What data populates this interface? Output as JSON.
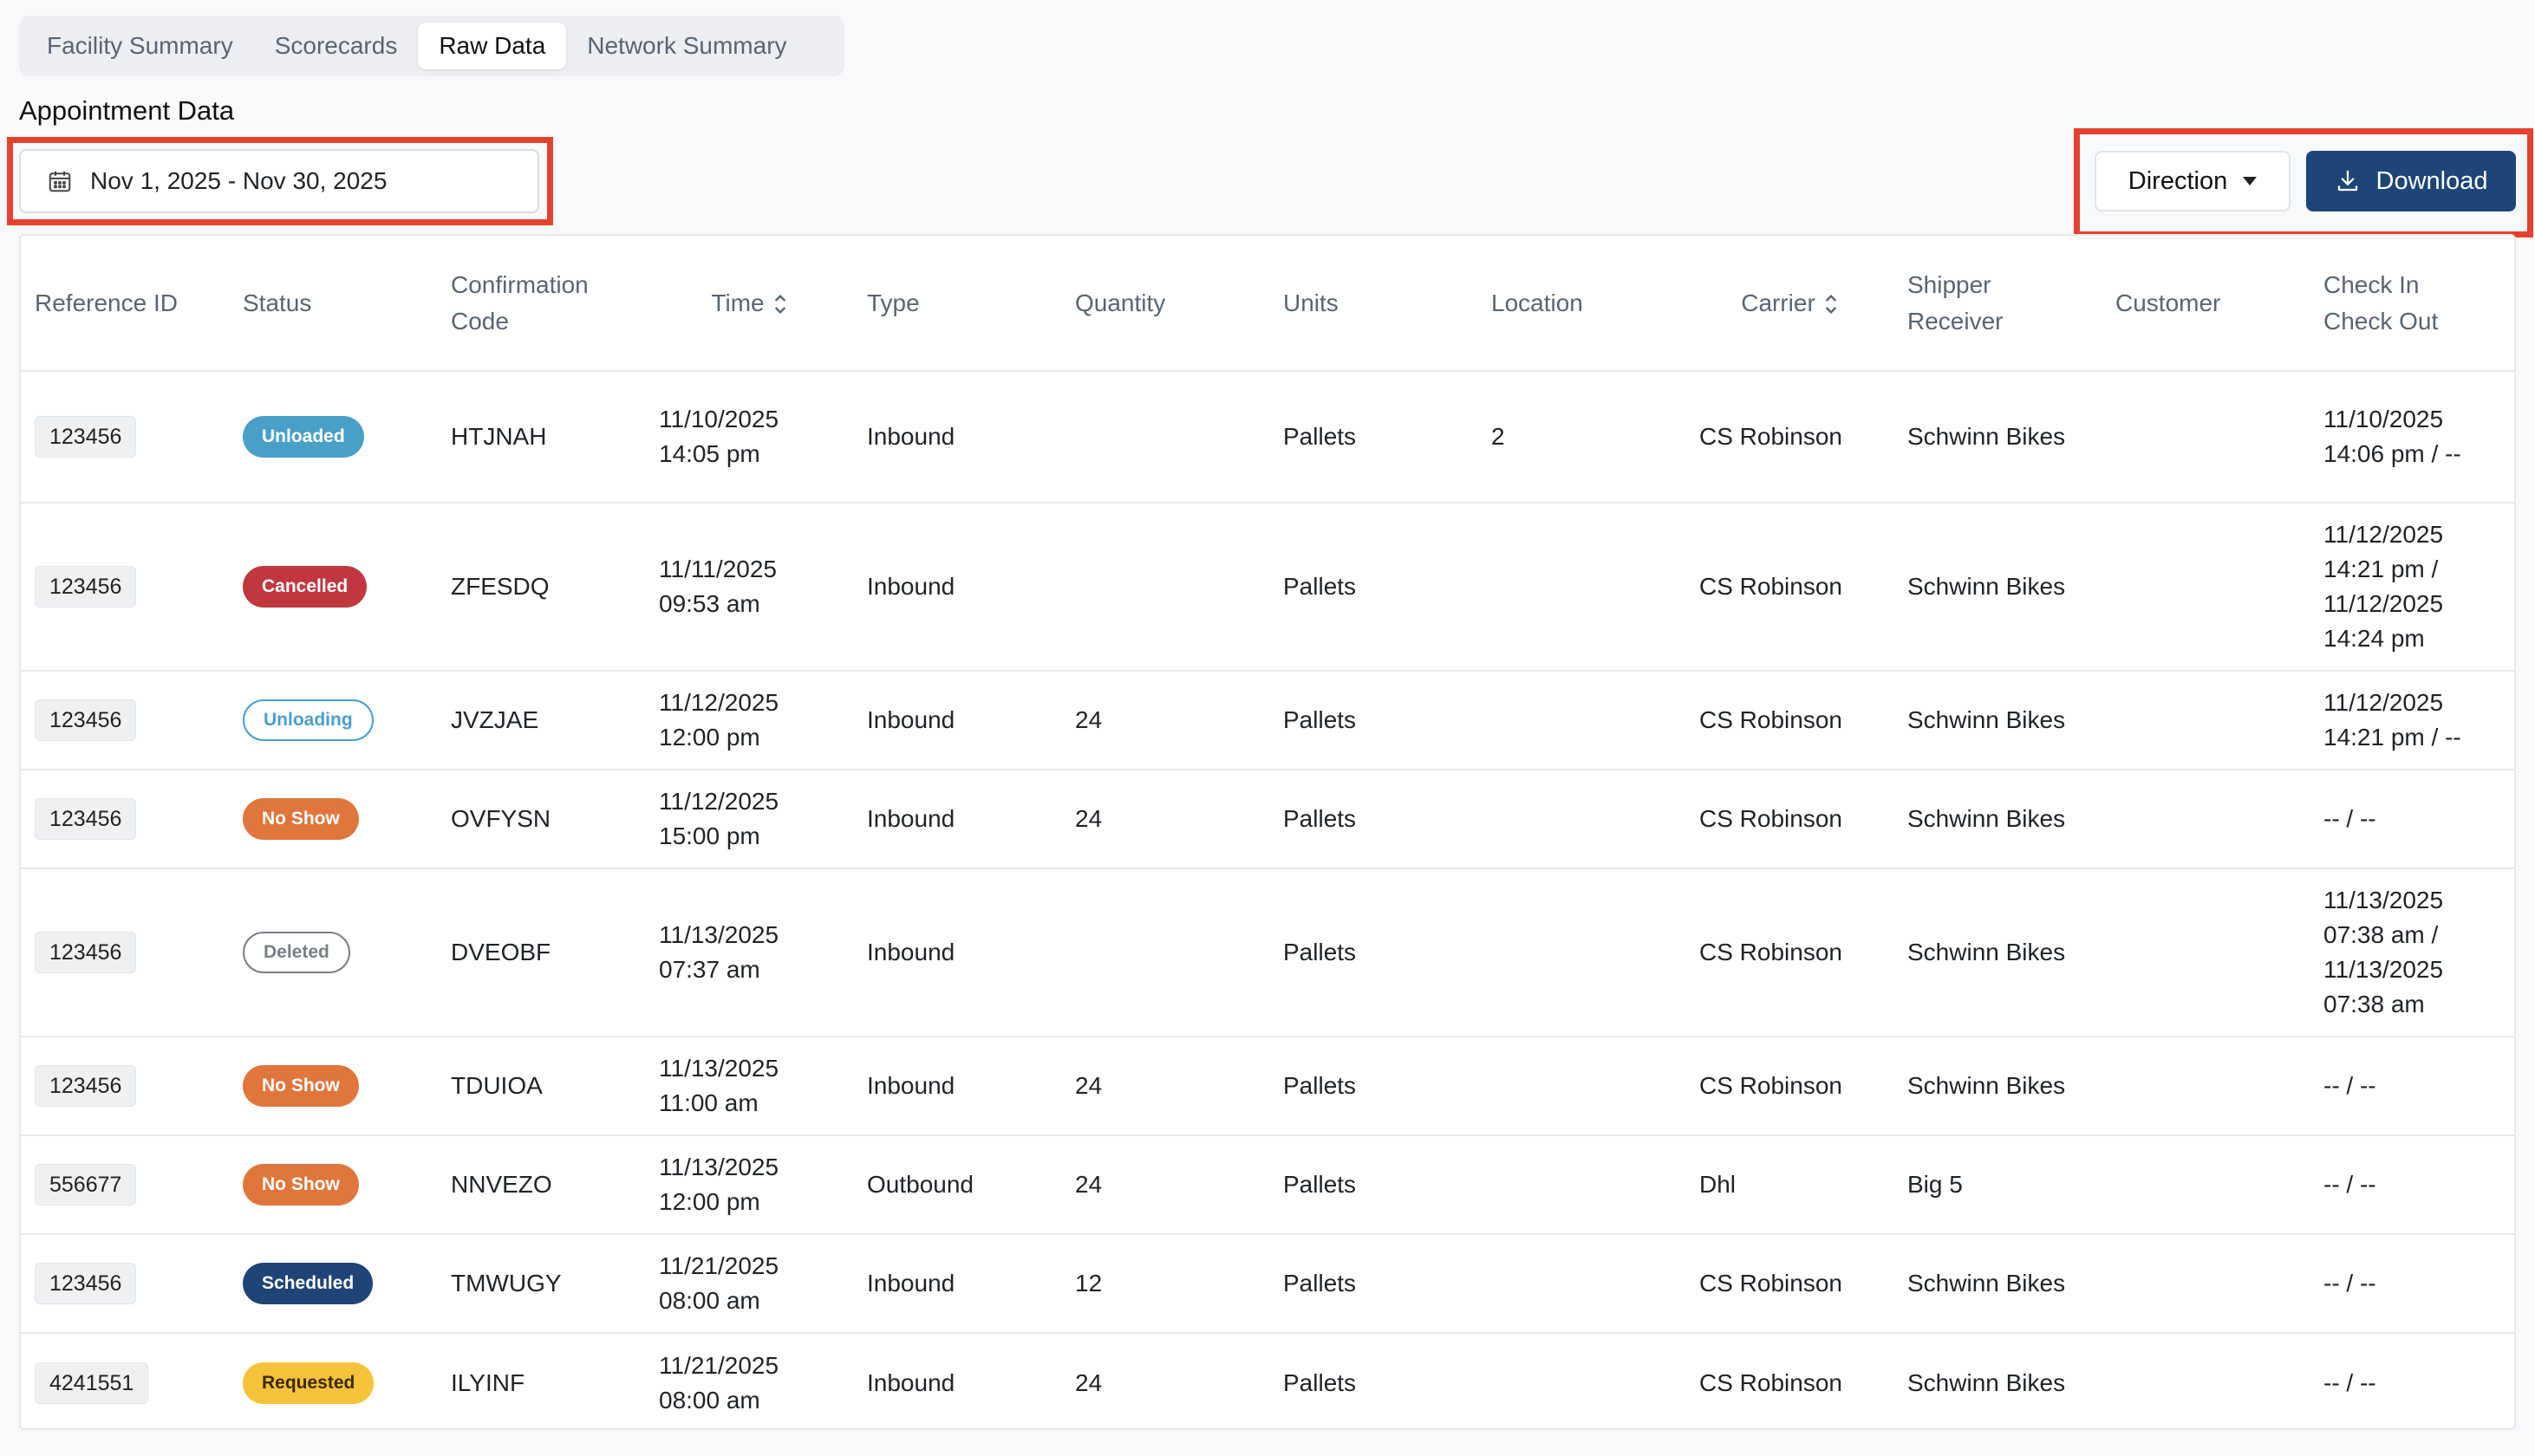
{
  "tabs": [
    {
      "label": "Facility Summary",
      "active": false
    },
    {
      "label": "Scorecards",
      "active": false
    },
    {
      "label": "Raw Data",
      "active": true
    },
    {
      "label": "Network Summary",
      "active": false
    }
  ],
  "section_title": "Appointment Data",
  "date_range": "Nov 1, 2025 - Nov 30, 2025",
  "direction_label": "Direction",
  "download_label": "Download",
  "colors": {
    "accent": "#1f4577",
    "highlight": "#e5412e",
    "unloaded": "#4a9fc9",
    "cancelled": "#c0383e",
    "unloading": "#4a9fc9",
    "no_show": "#e0763b",
    "deleted": "#7a7f86",
    "scheduled": "#1f4577",
    "requested": "#f5c23b"
  },
  "columns": [
    "Reference ID",
    "Status",
    "Confirmation\nCode",
    "Time",
    "Type",
    "Quantity",
    "Units",
    "Location",
    "Carrier",
    "Shipper\nReceiver",
    "Customer",
    "Check In\nCheck Out"
  ],
  "rows": [
    {
      "ref": "123456",
      "status": "Unloaded",
      "status_style": "unloaded",
      "code": "HTJNAH",
      "time": "11/10/2025\n14:05 pm",
      "type": "Inbound",
      "quantity": "",
      "units": "Pallets",
      "location": "2",
      "carrier": "CS Robinson",
      "shipper": "Schwinn Bikes",
      "customer": "",
      "check": "11/10/2025\n14:06 pm / --",
      "h": "h1"
    },
    {
      "ref": "123456",
      "status": "Cancelled",
      "status_style": "cancelled",
      "code": "ZFESDQ",
      "time": "11/11/2025\n09:53 am",
      "type": "Inbound",
      "quantity": "",
      "units": "Pallets",
      "location": "",
      "carrier": "CS Robinson",
      "shipper": "Schwinn Bikes",
      "customer": "",
      "check": "11/12/2025\n14:21 pm /\n11/12/2025\n14:24 pm",
      "h": "h2"
    },
    {
      "ref": "123456",
      "status": "Unloading",
      "status_style": "unloading",
      "code": "JVZJAE",
      "time": "11/12/2025\n12:00 pm",
      "type": "Inbound",
      "quantity": "24",
      "units": "Pallets",
      "location": "",
      "carrier": "CS Robinson",
      "shipper": "Schwinn Bikes",
      "customer": "",
      "check": "11/12/2025\n14:21 pm / --",
      "h": "h3"
    },
    {
      "ref": "123456",
      "status": "No Show",
      "status_style": "no_show",
      "code": "OVFYSN",
      "time": "11/12/2025\n15:00 pm",
      "type": "Inbound",
      "quantity": "24",
      "units": "Pallets",
      "location": "",
      "carrier": "CS Robinson",
      "shipper": "Schwinn Bikes",
      "customer": "",
      "check": "-- / --",
      "h": "h3"
    },
    {
      "ref": "123456",
      "status": "Deleted",
      "status_style": "deleted",
      "code": "DVEOBF",
      "time": "11/13/2025\n07:37 am",
      "type": "Inbound",
      "quantity": "",
      "units": "Pallets",
      "location": "",
      "carrier": "CS Robinson",
      "shipper": "Schwinn Bikes",
      "customer": "",
      "check": "11/13/2025\n07:38 am /\n11/13/2025\n07:38 am",
      "h": "h2"
    },
    {
      "ref": "123456",
      "status": "No Show",
      "status_style": "no_show",
      "code": "TDUIOA",
      "time": "11/13/2025\n11:00 am",
      "type": "Inbound",
      "quantity": "24",
      "units": "Pallets",
      "location": "",
      "carrier": "CS Robinson",
      "shipper": "Schwinn Bikes",
      "customer": "",
      "check": "-- / --",
      "h": "h3"
    },
    {
      "ref": "556677",
      "status": "No Show",
      "status_style": "no_show",
      "code": "NNVEZO",
      "time": "11/13/2025\n12:00 pm",
      "type": "Outbound",
      "quantity": "24",
      "units": "Pallets",
      "location": "",
      "carrier": "Dhl",
      "shipper": "Big 5",
      "customer": "",
      "check": "-- / --",
      "h": "h3"
    },
    {
      "ref": "123456",
      "status": "Scheduled",
      "status_style": "scheduled",
      "code": "TMWUGY",
      "time": "11/21/2025\n08:00 am",
      "type": "Inbound",
      "quantity": "12",
      "units": "Pallets",
      "location": "",
      "carrier": "CS Robinson",
      "shipper": "Schwinn Bikes",
      "customer": "",
      "check": "-- / --",
      "h": "h3"
    },
    {
      "ref": "4241551",
      "status": "Requested",
      "status_style": "requested",
      "code": "ILYINF",
      "time": "11/21/2025\n08:00 am",
      "type": "Inbound",
      "quantity": "24",
      "units": "Pallets",
      "location": "",
      "carrier": "CS Robinson",
      "shipper": "Schwinn Bikes",
      "customer": "",
      "check": "-- / --",
      "h": "h3"
    }
  ]
}
